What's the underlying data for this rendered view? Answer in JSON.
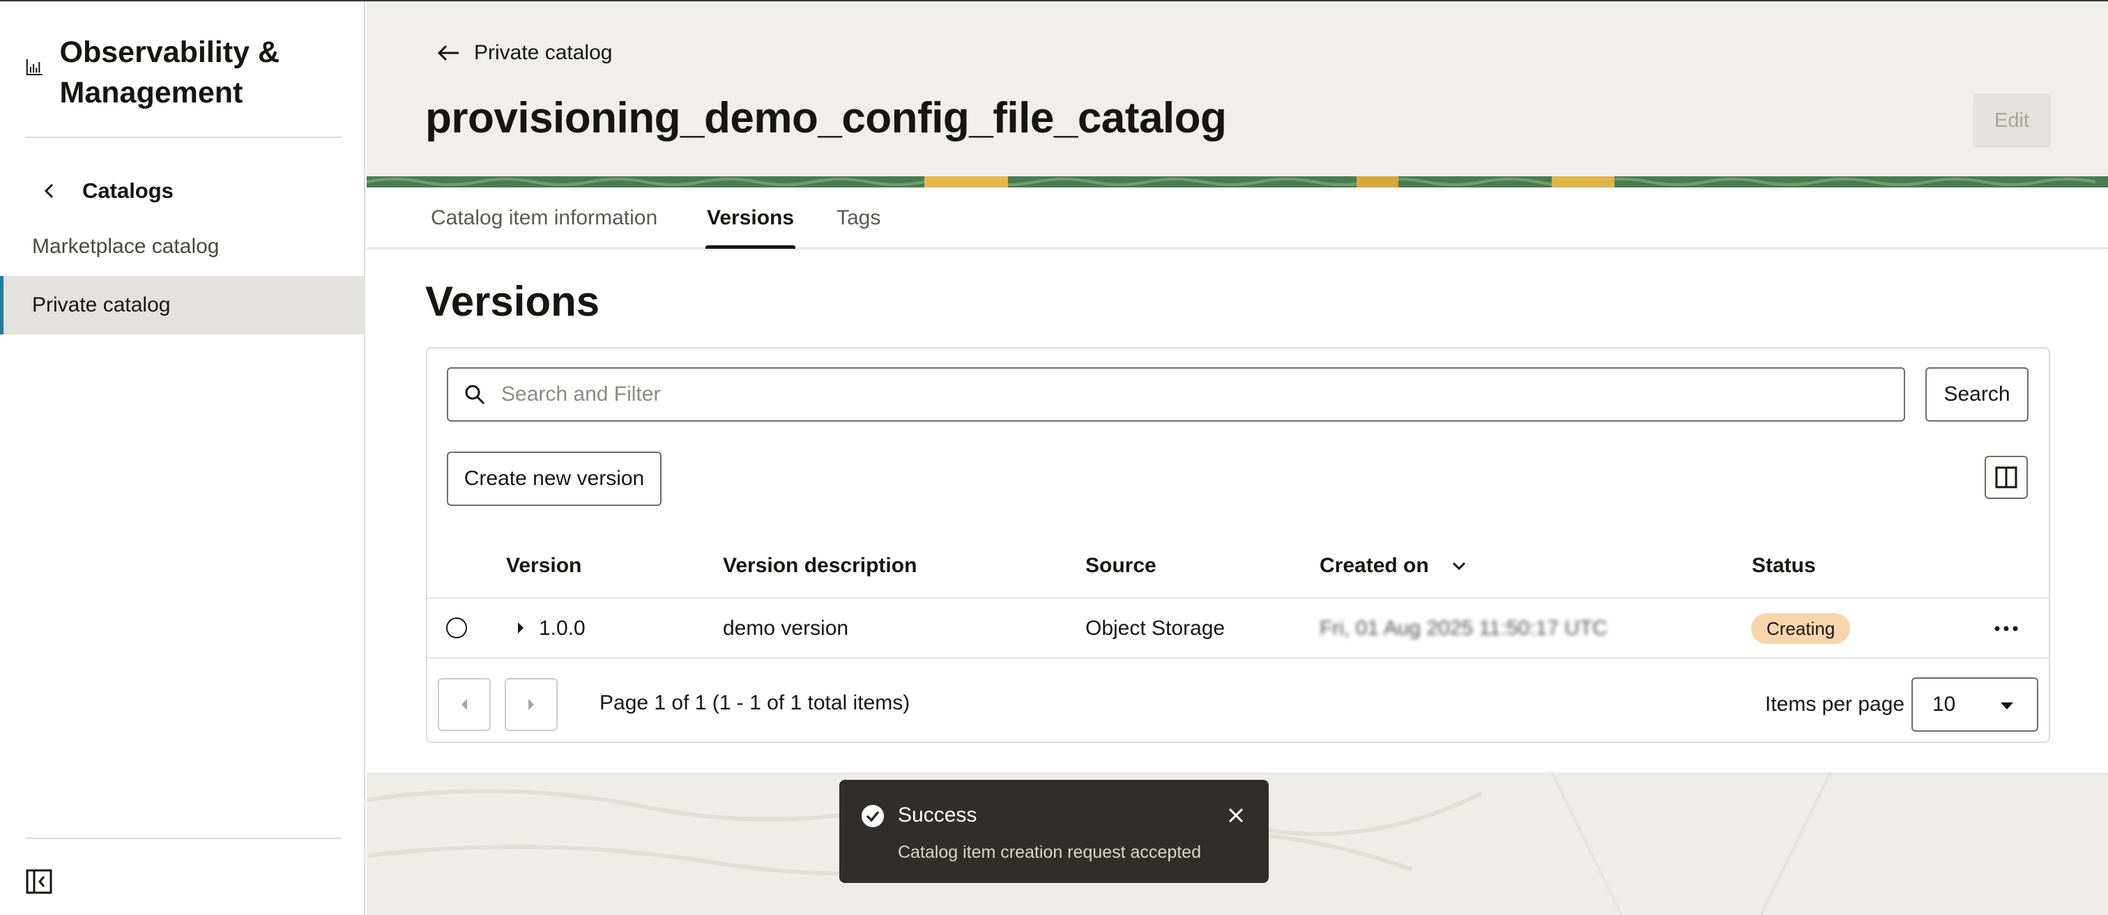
{
  "sidebar": {
    "app_title": "Observability & Management",
    "back_label": "Catalogs",
    "items": [
      {
        "label": "Marketplace catalog",
        "active": false
      },
      {
        "label": "Private catalog",
        "active": true
      }
    ]
  },
  "header": {
    "back_link": "Private catalog",
    "title": "provisioning_demo_config_file_catalog",
    "edit_label": "Edit"
  },
  "tabs": [
    {
      "label": "Catalog item information",
      "active": false
    },
    {
      "label": "Versions",
      "active": true
    },
    {
      "label": "Tags",
      "active": false
    }
  ],
  "versions": {
    "section_title": "Versions",
    "search_placeholder": "Search and Filter",
    "search_button": "Search",
    "create_button": "Create new version",
    "columns": [
      "Version",
      "Version description",
      "Source",
      "Created on",
      "Status"
    ],
    "rows": [
      {
        "version": "1.0.0",
        "description": "demo version",
        "source": "Object Storage",
        "created_on": "Fri, 01 Aug 2025 11:50:17 UTC",
        "status": "Creating"
      }
    ],
    "pagination": {
      "page_info": "Page 1 of 1 (1 - 1 of 1 total items)",
      "items_per_page_label": "Items per page",
      "items_per_page_value": "10"
    }
  },
  "toast": {
    "title": "Success",
    "message": "Catalog item creation request accepted"
  },
  "colors": {
    "accent": "#227e9e",
    "status_creating_bg": "#f8d5ab",
    "toast_bg": "#312d2a"
  }
}
